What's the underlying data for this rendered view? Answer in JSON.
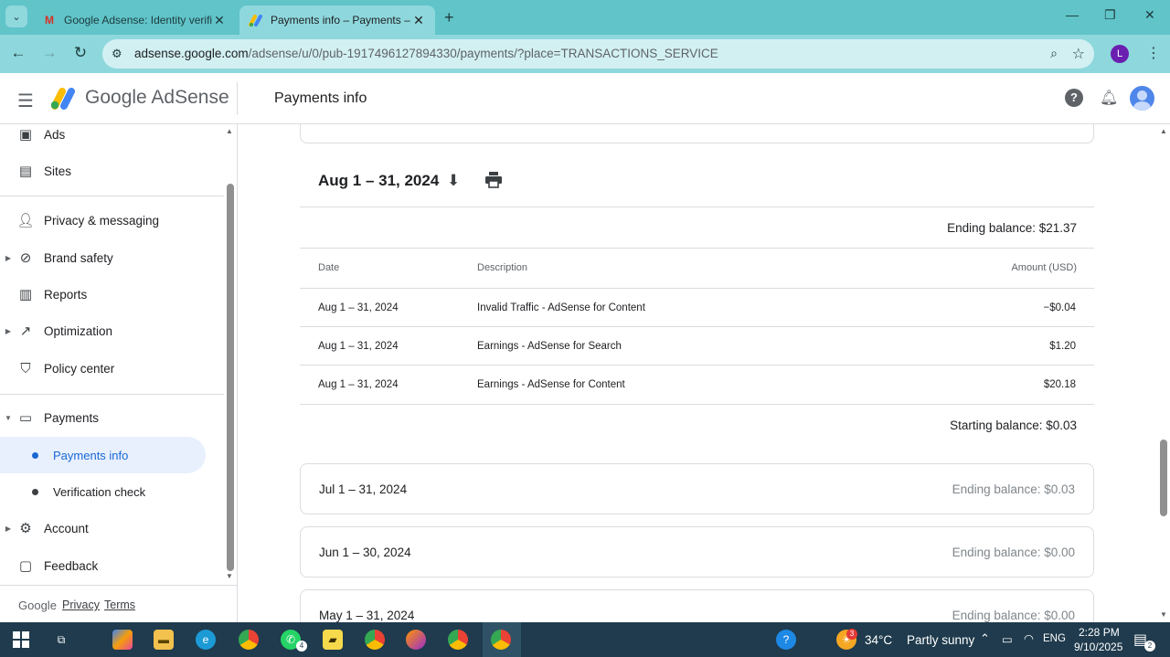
{
  "browser": {
    "tabs": [
      {
        "title": "Google Adsense: Identity verific",
        "active": false
      },
      {
        "title": "Payments info – Payments – Go",
        "active": true
      }
    ],
    "url_domain": "adsense.google.com",
    "url_path": "/adsense/u/0/pub-1917496127894330/payments/?place=TRANSACTIONS_SERVICE",
    "profile_initial": "L",
    "new_tab": "+",
    "close": "✕"
  },
  "header": {
    "logo_google": "Google",
    "logo_product": "AdSense",
    "page_title": "Payments info"
  },
  "sidebar": {
    "items": [
      {
        "label": "Ads",
        "icon": "ads-icon"
      },
      {
        "label": "Sites",
        "icon": "sites-icon"
      },
      {
        "label": "Privacy & messaging",
        "icon": "privacy-icon"
      },
      {
        "label": "Brand safety",
        "icon": "brand-safety-icon"
      },
      {
        "label": "Reports",
        "icon": "reports-icon"
      },
      {
        "label": "Optimization",
        "icon": "optimization-icon"
      },
      {
        "label": "Policy center",
        "icon": "policy-icon"
      },
      {
        "label": "Payments",
        "icon": "payments-icon"
      },
      {
        "label": "Account",
        "icon": "account-icon"
      },
      {
        "label": "Feedback",
        "icon": "feedback-icon"
      }
    ],
    "sub_items": [
      {
        "label": "Payments info",
        "active": true
      },
      {
        "label": "Verification check",
        "active": false
      }
    ],
    "footer": {
      "brand": "Google",
      "privacy": "Privacy",
      "terms": "Terms"
    }
  },
  "statement": {
    "period": "Aug 1 – 31, 2024",
    "ending_balance": "Ending balance: $21.37",
    "columns": {
      "date": "Date",
      "description": "Description",
      "amount": "Amount (USD)"
    },
    "rows": [
      {
        "date": "Aug 1 – 31, 2024",
        "description": "Invalid Traffic - AdSense for Content",
        "amount": "−$0.04"
      },
      {
        "date": "Aug 1 – 31, 2024",
        "description": "Earnings - AdSense for Search",
        "amount": "$1.20"
      },
      {
        "date": "Aug 1 – 31, 2024",
        "description": "Earnings - AdSense for Content",
        "amount": "$20.18"
      }
    ],
    "starting_balance": "Starting balance: $0.03"
  },
  "months": [
    {
      "label": "Jul 1 – 31, 2024",
      "balance": "Ending balance: $0.03"
    },
    {
      "label": "Jun 1 – 30, 2024",
      "balance": "Ending balance: $0.00"
    },
    {
      "label": "May 1 – 31, 2024",
      "balance": "Ending balance: $0.00"
    }
  ],
  "taskbar": {
    "weather_temp": "34°C",
    "weather_text": "Partly sunny",
    "language": "ENG",
    "time": "2:28 PM",
    "date": "9/10/2025",
    "whatsapp_badge": "4",
    "notif_badge": "2",
    "weather_badge": "3"
  },
  "colors": {
    "accent": "#1967d2",
    "tab_strip": "#60c4c9",
    "taskbar": "#1f3b4d"
  }
}
